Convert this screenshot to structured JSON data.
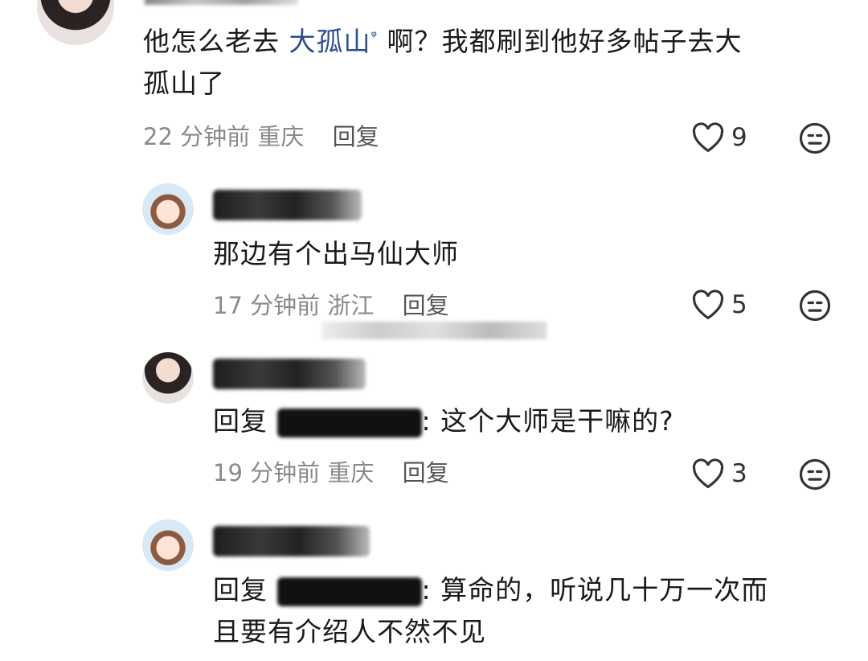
{
  "comments": [
    {
      "text_before": "他怎么老去 ",
      "link": "大孤山",
      "text_after": " 啊？我都刷到他好多帖子去大",
      "line2": "孤山了",
      "time": "22 分钟前",
      "location": "重庆",
      "reply_label": "回复",
      "likes": "9"
    }
  ],
  "replies": [
    {
      "text": "那边有个出马仙大师",
      "time": "17 分钟前",
      "location": "浙江",
      "reply_label": "回复",
      "likes": "5"
    },
    {
      "prefix": "回复",
      "suffix": ": 这个大师是干嘛的?",
      "time": "19 分钟前",
      "location": "重庆",
      "reply_label": "回复",
      "likes": "3"
    },
    {
      "prefix": "回复",
      "suffix": ": 算命的，听说几十万一次而",
      "line2": "且要有介绍人不然不见"
    }
  ]
}
